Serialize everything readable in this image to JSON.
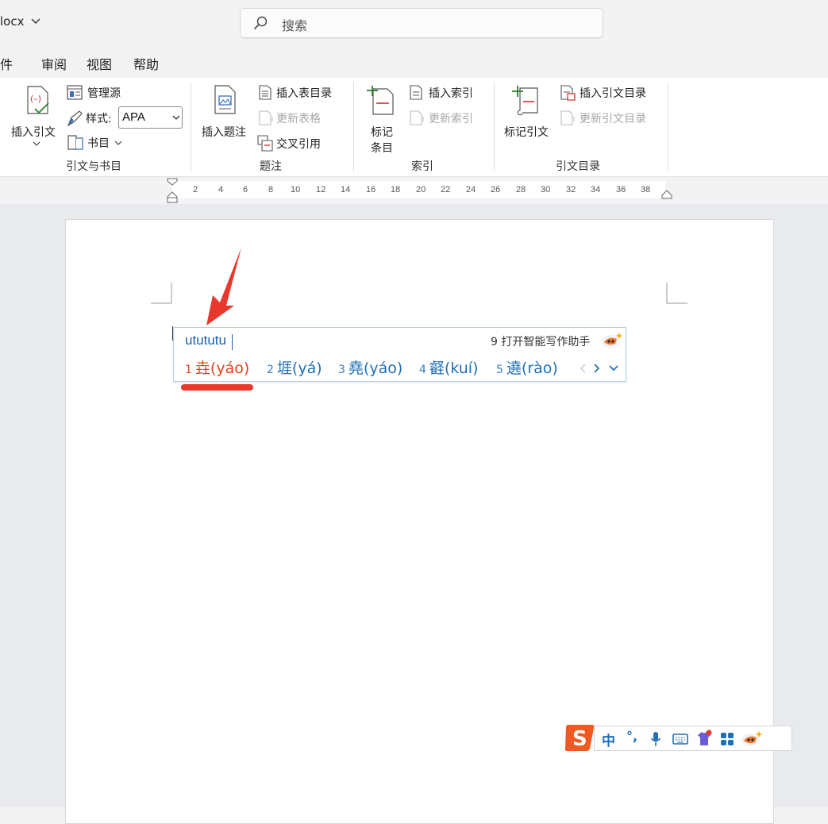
{
  "title_bar": {
    "doc_title": "locx",
    "search_placeholder": "搜索"
  },
  "menu_tabs": [
    "邮件",
    "审阅",
    "视图",
    "帮助"
  ],
  "ribbon": {
    "citations": {
      "insert_citation": "插入引文",
      "manage_sources": "管理源",
      "style_label": "样式:",
      "style_value": "APA",
      "bibliography": "书目",
      "group_label": "引文与书目"
    },
    "captions": {
      "insert_caption": "插入题注",
      "insert_table_of_figures": "插入表目录",
      "update_table": "更新表格",
      "cross_reference": "交叉引用",
      "group_label": "题注"
    },
    "index": {
      "mark_entry_line1": "标记",
      "mark_entry_line2": "条目",
      "insert_index": "插入索引",
      "update_index": "更新索引",
      "group_label": "索引"
    },
    "table_of_authorities": {
      "mark_citation": "标记引文",
      "insert_toa": "插入引文目录",
      "update_toa": "更新引文目录",
      "group_label": "引文目录"
    }
  },
  "ruler": {
    "ticks": [
      "2",
      "4",
      "6",
      "8",
      "10",
      "12",
      "14",
      "16",
      "18",
      "20",
      "22",
      "24",
      "26",
      "28",
      "30",
      "32",
      "34",
      "36",
      "38"
    ]
  },
  "ime_popup": {
    "input": "utututu",
    "assistant": "9 打开智能写作助手",
    "candidates": [
      {
        "num": "1",
        "text": "垚(yáo)"
      },
      {
        "num": "2",
        "text": "堐(yá)"
      },
      {
        "num": "3",
        "text": "堯(yáo)"
      },
      {
        "num": "4",
        "text": "壡(kuí)"
      },
      {
        "num": "5",
        "text": "遶(rào)"
      }
    ],
    "selected_index": 0
  },
  "ime_toolbar": {
    "logo": "S",
    "mode": "中",
    "punct": "°,"
  },
  "colors": {
    "accent_red": "#e8372b",
    "ime_blue": "#1f6fb5",
    "sogou_orange": "#f05a22"
  }
}
